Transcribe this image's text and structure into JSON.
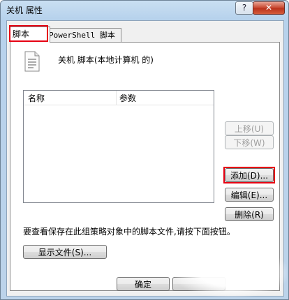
{
  "window": {
    "title": "关机 属性",
    "help_label": "?",
    "close_label": "✕"
  },
  "tabs": [
    {
      "label": "脚本"
    },
    {
      "label": "PowerShell 脚本"
    }
  ],
  "heading": "关机 脚本(本地计算机 的)",
  "list": {
    "columns": [
      "名称",
      "参数"
    ],
    "rows": []
  },
  "buttons": {
    "up": "上移(U)",
    "down": "下移(W)",
    "add": "添加(D)...",
    "edit": "编辑(E)...",
    "delete": "删除(R)",
    "show_files": "显示文件(S)...",
    "ok": "确定",
    "cancel": ""
  },
  "hint": "要查看保存在此组策略对象中的脚本文件,请按下面按钮。",
  "colors": {
    "highlight": "#e60012",
    "title_gradient_top": "#c9dff2"
  },
  "icons": [
    "document-script-icon"
  ]
}
